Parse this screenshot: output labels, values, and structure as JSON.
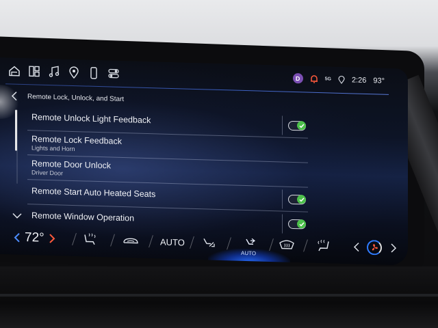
{
  "nav": {
    "icons": [
      "home-icon",
      "apps-icon",
      "music-icon",
      "location-icon",
      "phone-icon",
      "controls-icon"
    ]
  },
  "status": {
    "avatar_initial": "D",
    "network": "5G",
    "time": "2:26",
    "outside_temp": "93°"
  },
  "header": {
    "title": "Remote Lock, Unlock, and Start"
  },
  "settings": [
    {
      "label": "Remote Unlock Light Feedback",
      "sub": "",
      "toggle": true
    },
    {
      "label": "Remote Lock Feedback",
      "sub": "Lights and Horn",
      "toggle": false
    },
    {
      "label": "Remote Door Unlock",
      "sub": "Driver Door",
      "toggle": false
    },
    {
      "label": "Remote Start Auto Heated Seats",
      "sub": "",
      "toggle": true
    },
    {
      "label": "Remote Window Operation",
      "sub": "",
      "toggle": true
    }
  ],
  "climate": {
    "set_temp": "72°",
    "auto_label": "AUTO",
    "airflow_mode": "AUTO",
    "accent": "#2f6bff"
  },
  "colors": {
    "toggle_on": "#4cc04a",
    "accent_blue": "#3b5fc0"
  }
}
